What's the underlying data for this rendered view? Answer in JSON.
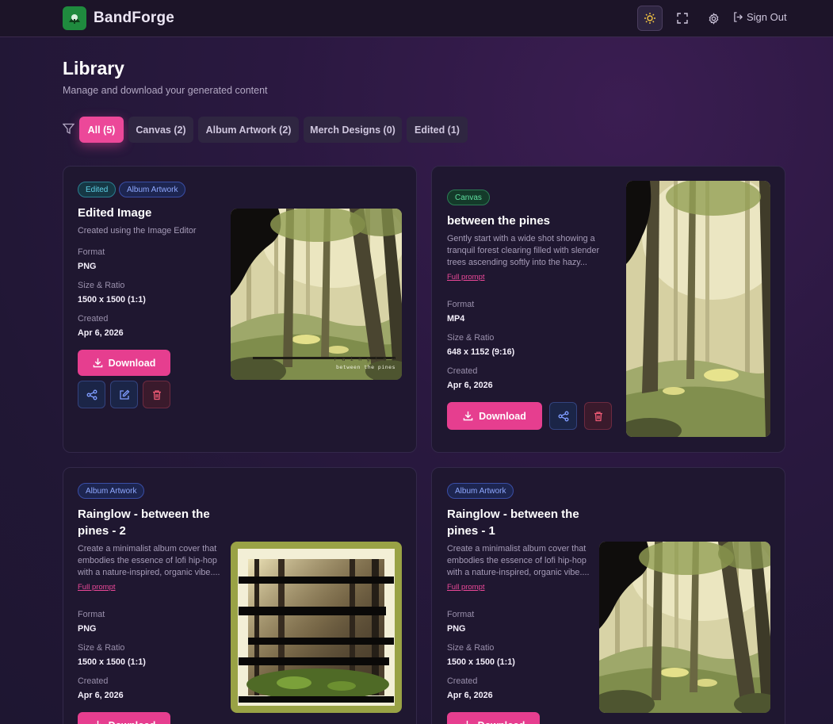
{
  "app": {
    "brand": "BandForge"
  },
  "nav": {
    "sign_out": "Sign Out"
  },
  "page": {
    "title": "Library",
    "subtitle": "Manage and download your generated content"
  },
  "tabs": [
    {
      "label": "All (5)",
      "active": true
    },
    {
      "label": "Canvas (2)",
      "active": false
    },
    {
      "label": "Album Artwork (2)",
      "active": false
    },
    {
      "label": "Merch Designs (0)",
      "active": false
    },
    {
      "label": "Edited (1)",
      "active": false
    }
  ],
  "labels": {
    "format": "Format",
    "size": "Size & Ratio",
    "created": "Created",
    "download": "Download",
    "full_prompt": "Full prompt"
  },
  "cards": [
    {
      "badges": [
        "Edited",
        "Album Artwork"
      ],
      "title": "Edited Image",
      "description": "Created using the Image Editor",
      "format": "PNG",
      "size": "1500 x 1500 (1:1)",
      "created": "Apr 6, 2026",
      "thumb_text_1": "r a i n g l o w",
      "thumb_text_2": "between the pines"
    },
    {
      "badges": [
        "Canvas"
      ],
      "title": "between the pines",
      "description": "Gently start with a wide shot showing a tranquil forest clearing filled with slender trees ascending softly into the hazy...",
      "format": "MP4",
      "size": "648 x 1152 (9:16)",
      "created": "Apr 6, 2026"
    },
    {
      "badges": [
        "Album Artwork"
      ],
      "title": "Rainglow - between the pines - 2",
      "description": "Create a minimalist album cover that embodies the essence of lofi hip-hop with a nature-inspired, organic vibe....",
      "format": "PNG",
      "size": "1500 x 1500 (1:1)",
      "created": "Apr 6, 2026"
    },
    {
      "badges": [
        "Album Artwork"
      ],
      "title": "Rainglow - between the pines - 1",
      "description": "Create a minimalist album cover that embodies the essence of lofi hip-hop with a nature-inspired, organic vibe....",
      "format": "PNG",
      "size": "1500 x 1500 (1:1)",
      "created": "Apr 6, 2026"
    }
  ],
  "colors": {
    "accent": "#ec4899",
    "background": "#221733",
    "card": "#1f1730"
  }
}
